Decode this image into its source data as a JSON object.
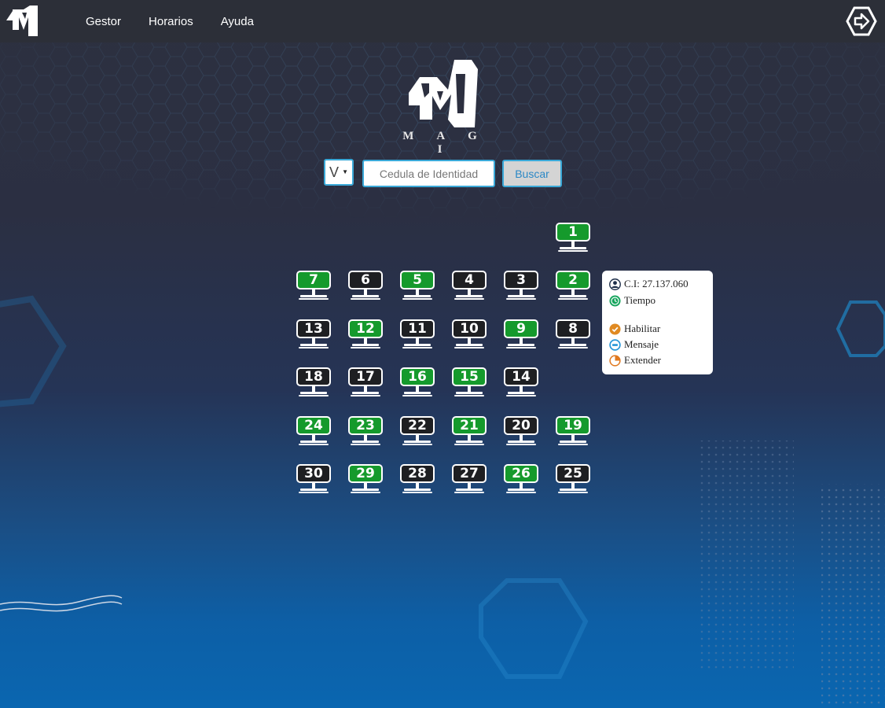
{
  "nav": {
    "logo_icon": "magi-logo-icon",
    "links": [
      "Gestor",
      "Horarios",
      "Ayuda"
    ],
    "exit_icon": "logout-icon"
  },
  "brand": {
    "name": "M A G I",
    "logo_icon": "magi-logo-icon"
  },
  "search": {
    "doc_type": "V",
    "placeholder": "Cedula de Identidad",
    "button_label": "Buscar"
  },
  "colors": {
    "on": "#159a2c",
    "off": "#1e1f22",
    "accent": "#3aa9d8"
  },
  "computers": [
    {
      "label": "1",
      "status": "on"
    },
    {
      "label": "7",
      "status": "on"
    },
    {
      "label": "6",
      "status": "off"
    },
    {
      "label": "5",
      "status": "on"
    },
    {
      "label": "4",
      "status": "off"
    },
    {
      "label": "3",
      "status": "off"
    },
    {
      "label": "2",
      "status": "on"
    },
    {
      "label": "13",
      "status": "off"
    },
    {
      "label": "12",
      "status": "on"
    },
    {
      "label": "11",
      "status": "off"
    },
    {
      "label": "10",
      "status": "off"
    },
    {
      "label": "9",
      "status": "on"
    },
    {
      "label": "8",
      "status": "off"
    },
    {
      "label": "18",
      "status": "off"
    },
    {
      "label": "17",
      "status": "off"
    },
    {
      "label": "16",
      "status": "on"
    },
    {
      "label": "15",
      "status": "on"
    },
    {
      "label": "14",
      "status": "off"
    },
    {
      "label": "24",
      "status": "on"
    },
    {
      "label": "23",
      "status": "on"
    },
    {
      "label": "22",
      "status": "off"
    },
    {
      "label": "21",
      "status": "on"
    },
    {
      "label": "20",
      "status": "off"
    },
    {
      "label": "19",
      "status": "on"
    },
    {
      "label": "30",
      "status": "off"
    },
    {
      "label": "29",
      "status": "on"
    },
    {
      "label": "28",
      "status": "off"
    },
    {
      "label": "27",
      "status": "off"
    },
    {
      "label": "26",
      "status": "on"
    },
    {
      "label": "25",
      "status": "off"
    }
  ],
  "popup": {
    "ci": "C.I: 27.137.060",
    "tiempo": "Tiempo",
    "habilitar": "Habilitar",
    "mensaje": "Mensaje",
    "extender": "Extender"
  }
}
